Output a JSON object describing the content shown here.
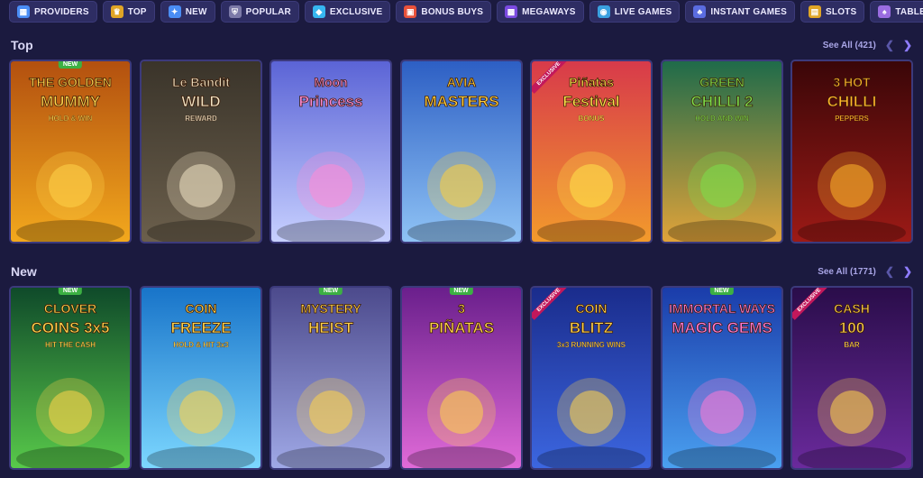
{
  "categories": [
    {
      "label": "PROVIDERS",
      "icon": "providers-icon",
      "color": "#4a8df5",
      "glyph": "▦"
    },
    {
      "label": "TOP",
      "icon": "trophy-icon",
      "color": "#e0a526",
      "glyph": "♛"
    },
    {
      "label": "NEW",
      "icon": "new-icon",
      "color": "#4a8df5",
      "glyph": "✦"
    },
    {
      "label": "POPULAR",
      "icon": "shield-icon",
      "color": "#7c7aa8",
      "glyph": "⛨"
    },
    {
      "label": "EXCLUSIVE",
      "icon": "diamond-icon",
      "color": "#36b6f0",
      "glyph": "◆"
    },
    {
      "label": "BONUS BUYS",
      "icon": "gift-icon",
      "color": "#e8513a",
      "glyph": "▣"
    },
    {
      "label": "MEGAWAYS",
      "icon": "megaways-icon",
      "color": "#7b4ae0",
      "glyph": "▩"
    },
    {
      "label": "LIVE GAMES",
      "icon": "globe-icon",
      "color": "#3aa0e0",
      "glyph": "◉"
    },
    {
      "label": "INSTANT GAMES",
      "icon": "instant-icon",
      "color": "#5a6ce0",
      "glyph": "♣"
    },
    {
      "label": "SLOTS",
      "icon": "slots-icon",
      "color": "#e0a526",
      "glyph": "▤"
    },
    {
      "label": "TABLE GAMES",
      "icon": "cards-icon",
      "color": "#9a6ce0",
      "glyph": "♠"
    }
  ],
  "sections": {
    "top": {
      "title": "Top",
      "see_all": "See All (421)"
    },
    "new": {
      "title": "New",
      "see_all": "See All (1771)"
    }
  },
  "top_games": [
    {
      "name": "the-golden-mummy",
      "badge": "NEW",
      "l1": "THE GOLDEN",
      "l2": "MUMMY",
      "l3": "HOLD & WIN",
      "bg1": "#b3500f",
      "bg2": "#f2a81d",
      "fg": "#ffd34a",
      "icon": "mummy-icon"
    },
    {
      "name": "le-bandit",
      "l1": "Le Bandit",
      "l2": "WILD",
      "l3": "REWARD",
      "bg1": "#3a342a",
      "bg2": "#6b5f4c",
      "fg": "#f1e4c4",
      "icon": "wanted-poster-icon"
    },
    {
      "name": "moon-princess",
      "l1": "Moon",
      "l2": "Princess",
      "l3": "",
      "bg1": "#5b64d6",
      "bg2": "#c7d0ff",
      "fg": "#ff8bd6",
      "icon": "princess-icon"
    },
    {
      "name": "avia-masters",
      "l1": "AVIA",
      "l2": "MASTERS",
      "l3": "",
      "bg1": "#2d5fc4",
      "bg2": "#8fc3f5",
      "fg": "#ffcf3a",
      "icon": "airplane-icon"
    },
    {
      "name": "pinatas-festival",
      "excl": "EXCLUSIVE",
      "l1": "Piñatas",
      "l2": "Festival",
      "l3": "BONUS",
      "bg1": "#d83a4a",
      "bg2": "#f29a2c",
      "fg": "#ffe34a",
      "icon": "pinata-icon"
    },
    {
      "name": "green-chilli-2",
      "l1": "GREEN",
      "l2": "CHILLI 2",
      "l3": "HOLD AND WIN",
      "bg1": "#1f6b4a",
      "bg2": "#e0a33a",
      "fg": "#7be04a",
      "icon": "mariachi-icon"
    },
    {
      "name": "3-hot-chilli-peppers",
      "l1": "3 HOT",
      "l2": "CHILLI",
      "l3": "PEPPERS",
      "bg1": "#3a0608",
      "bg2": "#9c1a16",
      "fg": "#ffb72a",
      "icon": "pepper-icon"
    }
  ],
  "new_games": [
    {
      "name": "clover-coins-3x5",
      "badge": "NEW",
      "l1": "CLOVER",
      "l2": "COINS 3x5",
      "l3": "HIT THE CASH",
      "bg1": "#0f4a2a",
      "bg2": "#58c94a",
      "fg": "#ffd34a",
      "icon": "pot-of-gold-icon"
    },
    {
      "name": "coin-freeze",
      "l1": "COIN",
      "l2": "FREEZE",
      "l3": "HOLD & HIT 3x3",
      "bg1": "#1874c9",
      "bg2": "#7cd7ff",
      "fg": "#ffd34a",
      "icon": "crown-icon"
    },
    {
      "name": "mystery-heist",
      "badge": "NEW",
      "l1": "MYSTERY",
      "l2": "HEIST",
      "l3": "",
      "bg1": "#4c4a8c",
      "bg2": "#9fa8e6",
      "fg": "#ffd34a",
      "icon": "thief-icon"
    },
    {
      "name": "3-pinatas",
      "badge": "NEW",
      "l1": "3",
      "l2": "PIÑATAS",
      "l3": "",
      "bg1": "#6a1f8c",
      "bg2": "#e06ad8",
      "fg": "#ffd34a",
      "icon": "cactus-icon"
    },
    {
      "name": "coin-blitz",
      "excl": "EXCLUSIVE",
      "l1": "COIN",
      "l2": "BLITZ",
      "l3": "3x3 RUNNING WINS",
      "bg1": "#1a2c8c",
      "bg2": "#3c66e0",
      "fg": "#ffd34a",
      "icon": "lightning-icon"
    },
    {
      "name": "immortal-ways-magic-gems",
      "badge": "NEW",
      "l1": "IMMORTAL WAYS",
      "l2": "MAGIC GEMS",
      "l3": "",
      "bg1": "#1a3caa",
      "bg2": "#4aa0f0",
      "fg": "#ff7ad6",
      "icon": "treasure-chest-icon"
    },
    {
      "name": "cash-100",
      "excl": "EXCLUSIVE",
      "l1": "CASH",
      "l2": "100",
      "l3": "BAR",
      "bg1": "#2a0d4a",
      "bg2": "#6a2a9c",
      "fg": "#ffd34a",
      "icon": "gold-bars-icon"
    }
  ]
}
